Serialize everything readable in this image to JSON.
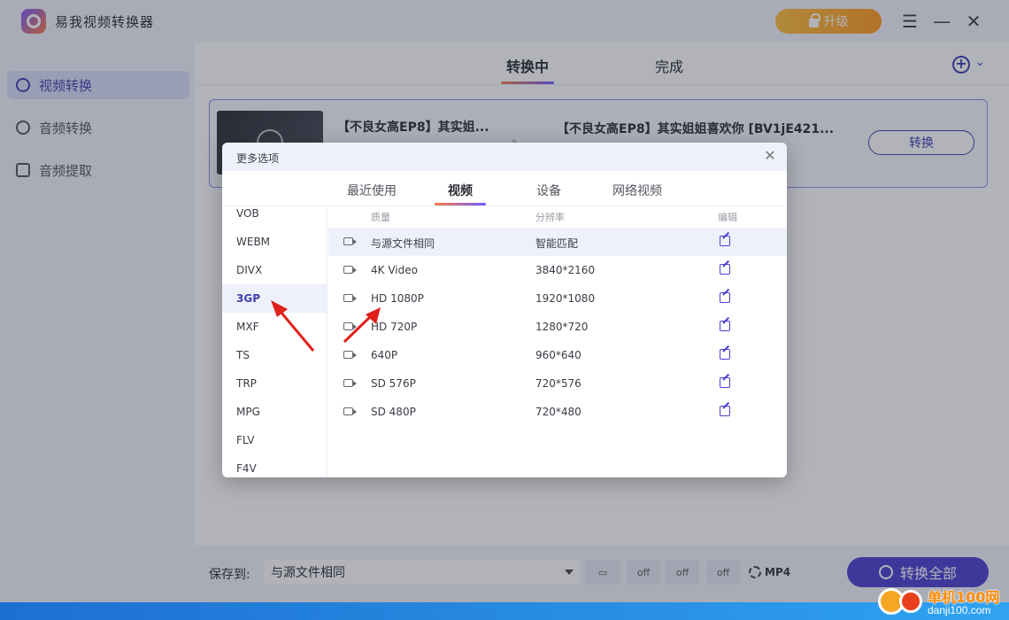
{
  "app": {
    "title": "易我视频转换器",
    "upgrade_label": "升级",
    "window_controls": {
      "menu": "☰",
      "minimize": "—",
      "close": "✕"
    }
  },
  "sidebar": {
    "items": [
      {
        "label": "视频转换",
        "icon": "video-convert-icon",
        "active": true
      },
      {
        "label": "音频转换",
        "icon": "audio-convert-icon",
        "active": false
      },
      {
        "label": "音频提取",
        "icon": "audio-extract-icon",
        "active": false
      }
    ]
  },
  "main": {
    "tabs": [
      {
        "label": "转换中",
        "active": true
      },
      {
        "label": "完成",
        "active": false
      }
    ],
    "task": {
      "source_name": "【不良女高EP8】其实姐...",
      "target_name": "【不良女高EP8】其实姐姐喜欢你 [BV1jE421...",
      "convert_label": "转换"
    },
    "bottom": {
      "save_to_label": "保存到:",
      "save_to_value": "与源文件相同",
      "format_label": "MP4",
      "convert_all_label": "转换全部",
      "tool_labels": [
        "off",
        "off",
        "off"
      ]
    }
  },
  "dialog": {
    "title": "更多选项",
    "close": "✕",
    "tabs": [
      {
        "label": "最近使用",
        "active": false
      },
      {
        "label": "视频",
        "active": true
      },
      {
        "label": "设备",
        "active": false
      },
      {
        "label": "网络视频",
        "active": false
      }
    ],
    "formats": [
      "VOB",
      "WEBM",
      "DIVX",
      "3GP",
      "MXF",
      "TS",
      "TRP",
      "MPG",
      "FLV",
      "F4V"
    ],
    "selected_format": "3GP",
    "table_headers": {
      "quality": "质量",
      "resolution": "分辨率",
      "edit": "编辑"
    },
    "rows": [
      {
        "quality": "与源文件相同",
        "resolution": "智能匹配"
      },
      {
        "quality": "4K Video",
        "resolution": "3840*2160"
      },
      {
        "quality": "HD 1080P",
        "resolution": "1920*1080"
      },
      {
        "quality": "HD 720P",
        "resolution": "1280*720"
      },
      {
        "quality": "640P",
        "resolution": "960*640"
      },
      {
        "quality": "SD 576P",
        "resolution": "720*576"
      },
      {
        "quality": "SD 480P",
        "resolution": "720*480"
      }
    ]
  },
  "watermark": {
    "brand": "单机100网",
    "url": "danji100.com"
  },
  "colors": {
    "accent": "#4b3fd0",
    "upgrade": "#ff9a1f",
    "annotation": "#e0201a"
  }
}
